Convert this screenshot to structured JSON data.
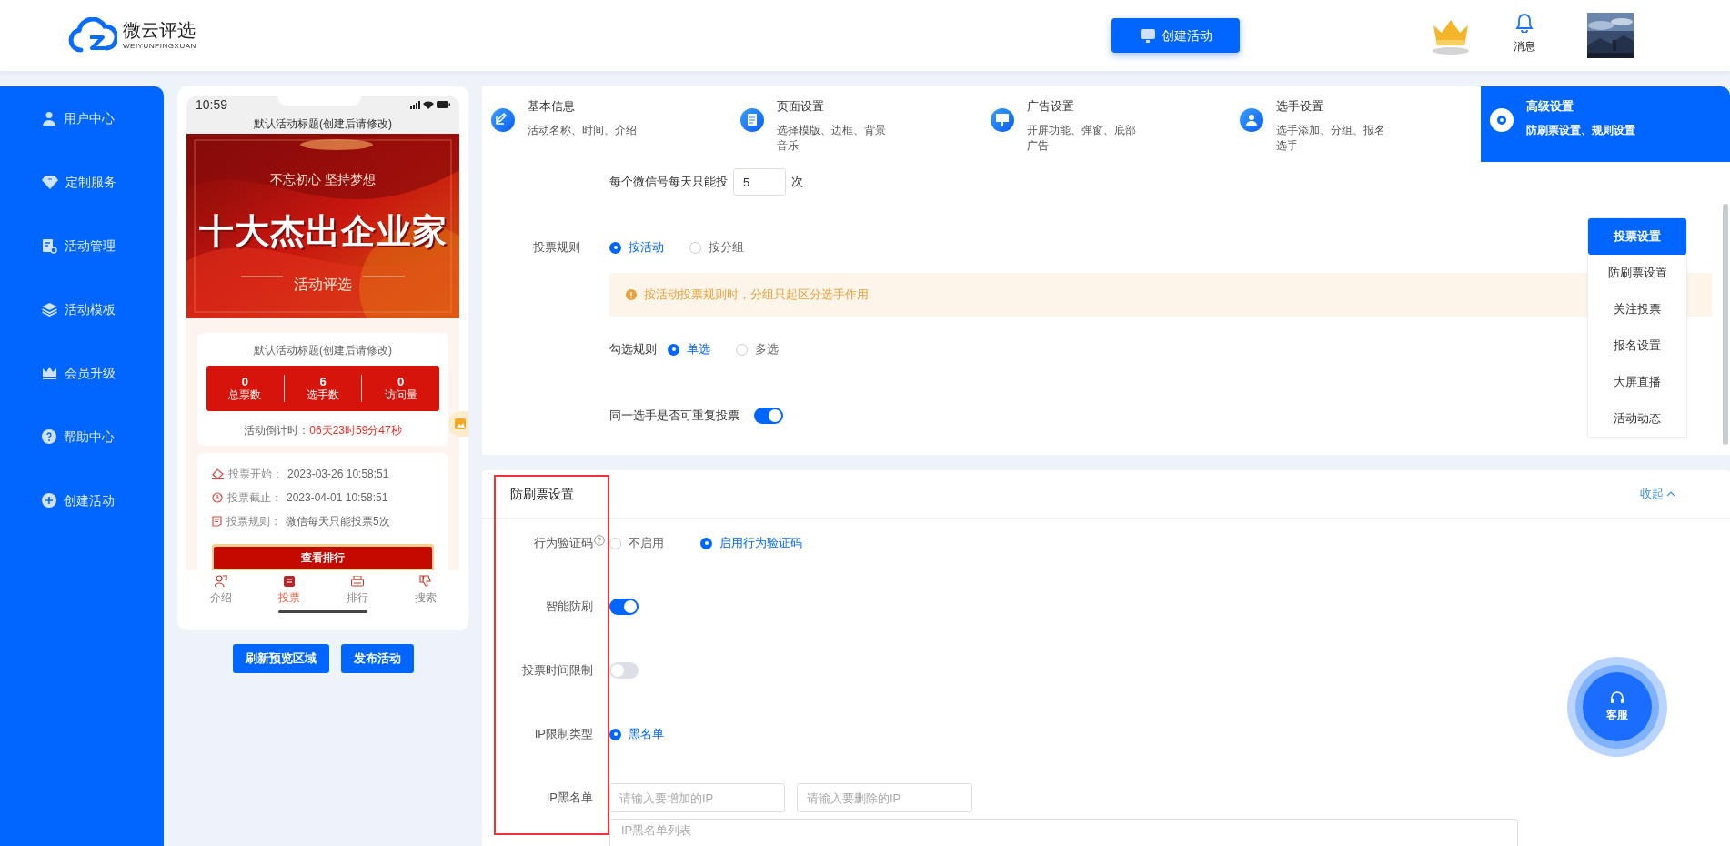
{
  "header": {
    "logo_name": "微云评选",
    "logo_subtitle": "WEIYUNPINGXUAN",
    "create_button": "创建活动",
    "messages": "消息"
  },
  "sidebar": {
    "items": [
      "用户中心",
      "定制服务",
      "活动管理",
      "活动模板",
      "会员升级",
      "帮助中心",
      "创建活动"
    ]
  },
  "preview": {
    "time": "10:59",
    "page_title": "默认活动标题(创建后请修改)",
    "banner": {
      "slogan": "不忘初心 坚持梦想",
      "headline": "十大杰出企业家",
      "subtitle": "活动评选"
    },
    "card_title": "默认活动标题(创建后请修改)",
    "stats": [
      {
        "value": "0",
        "label": "总票数"
      },
      {
        "value": "6",
        "label": "选手数"
      },
      {
        "value": "0",
        "label": "访问量"
      }
    ],
    "countdown_label": "活动倒计时：",
    "countdown": "06天23时59分47秒",
    "info": [
      {
        "label": "投票开始：",
        "value": "2023-03-26 10:58:51"
      },
      {
        "label": "投票截止：",
        "value": "2023-04-01 10:58:51"
      },
      {
        "label": "投票规则：",
        "value": "微信每天只能投票5次"
      }
    ],
    "ranking_button": "查看排行",
    "tabs": [
      {
        "label": "介绍",
        "selected": false
      },
      {
        "label": "投票",
        "selected": true
      },
      {
        "label": "排行",
        "selected": false
      },
      {
        "label": "搜索",
        "selected": false
      }
    ]
  },
  "preview_buttons": [
    "刷新预览区域",
    "发布活动"
  ],
  "steps": [
    {
      "title": "基本信息",
      "desc": "活动名称、时间、介绍",
      "selected": false
    },
    {
      "title": "页面设置",
      "desc": "选择模版、边框、背景音乐",
      "selected": false
    },
    {
      "title": "广告设置",
      "desc": "开屏功能、弹窗、底部广告",
      "selected": false
    },
    {
      "title": "选手设置",
      "desc": "选手添加、分组、报名选手",
      "selected": false
    },
    {
      "title": "高级设置",
      "desc": "防刷票设置、规则设置",
      "selected": true
    }
  ],
  "vote_settings": {
    "daily_limit": {
      "label": "每个微信号每天只能投",
      "value": "5",
      "unit": "次"
    },
    "vote_rule": {
      "label": "投票规则",
      "options": [
        {
          "label": "按活动",
          "selected": true
        },
        {
          "label": "按分组",
          "selected": false
        }
      ]
    },
    "notice": "按活动投票规则时，分组只起区分选手作用",
    "check_rule": {
      "label": "勾选规则",
      "options": [
        {
          "label": "单选",
          "selected": true
        },
        {
          "label": "多选",
          "selected": false
        }
      ]
    },
    "repeat_vote": {
      "label": "同一选手是否可重复投票",
      "on": true
    }
  },
  "section_nav": [
    {
      "label": "投票设置",
      "selected": true
    },
    {
      "label": "防刷票设置",
      "selected": false
    },
    {
      "label": "关注投票",
      "selected": false
    },
    {
      "label": "报名设置",
      "selected": false
    },
    {
      "label": "大屏直播",
      "selected": false
    },
    {
      "label": "活动动态",
      "selected": false
    }
  ],
  "anti_fraud": {
    "title": "防刷票设置",
    "collapse": "收起",
    "rows": [
      {
        "kind": "radio",
        "label": "行为验证码",
        "options": [
          {
            "label": "不启用",
            "selected": false
          },
          {
            "label": "启用行为验证码",
            "selected": true
          }
        ]
      },
      {
        "kind": "toggle",
        "label": "智能防刷",
        "on": true
      },
      {
        "kind": "toggle",
        "label": "投票时间限制",
        "on": false
      },
      {
        "kind": "radio",
        "label": "IP限制类型",
        "options": [
          {
            "label": "黑名单",
            "selected": true
          }
        ]
      },
      {
        "kind": "inputs",
        "label": "IP黑名单",
        "placeholders": [
          "请输入要增加的IP",
          "请输入要删除的IP"
        ]
      }
    ],
    "list_placeholder": "IP黑名单列表"
  },
  "service_button": "客服"
}
